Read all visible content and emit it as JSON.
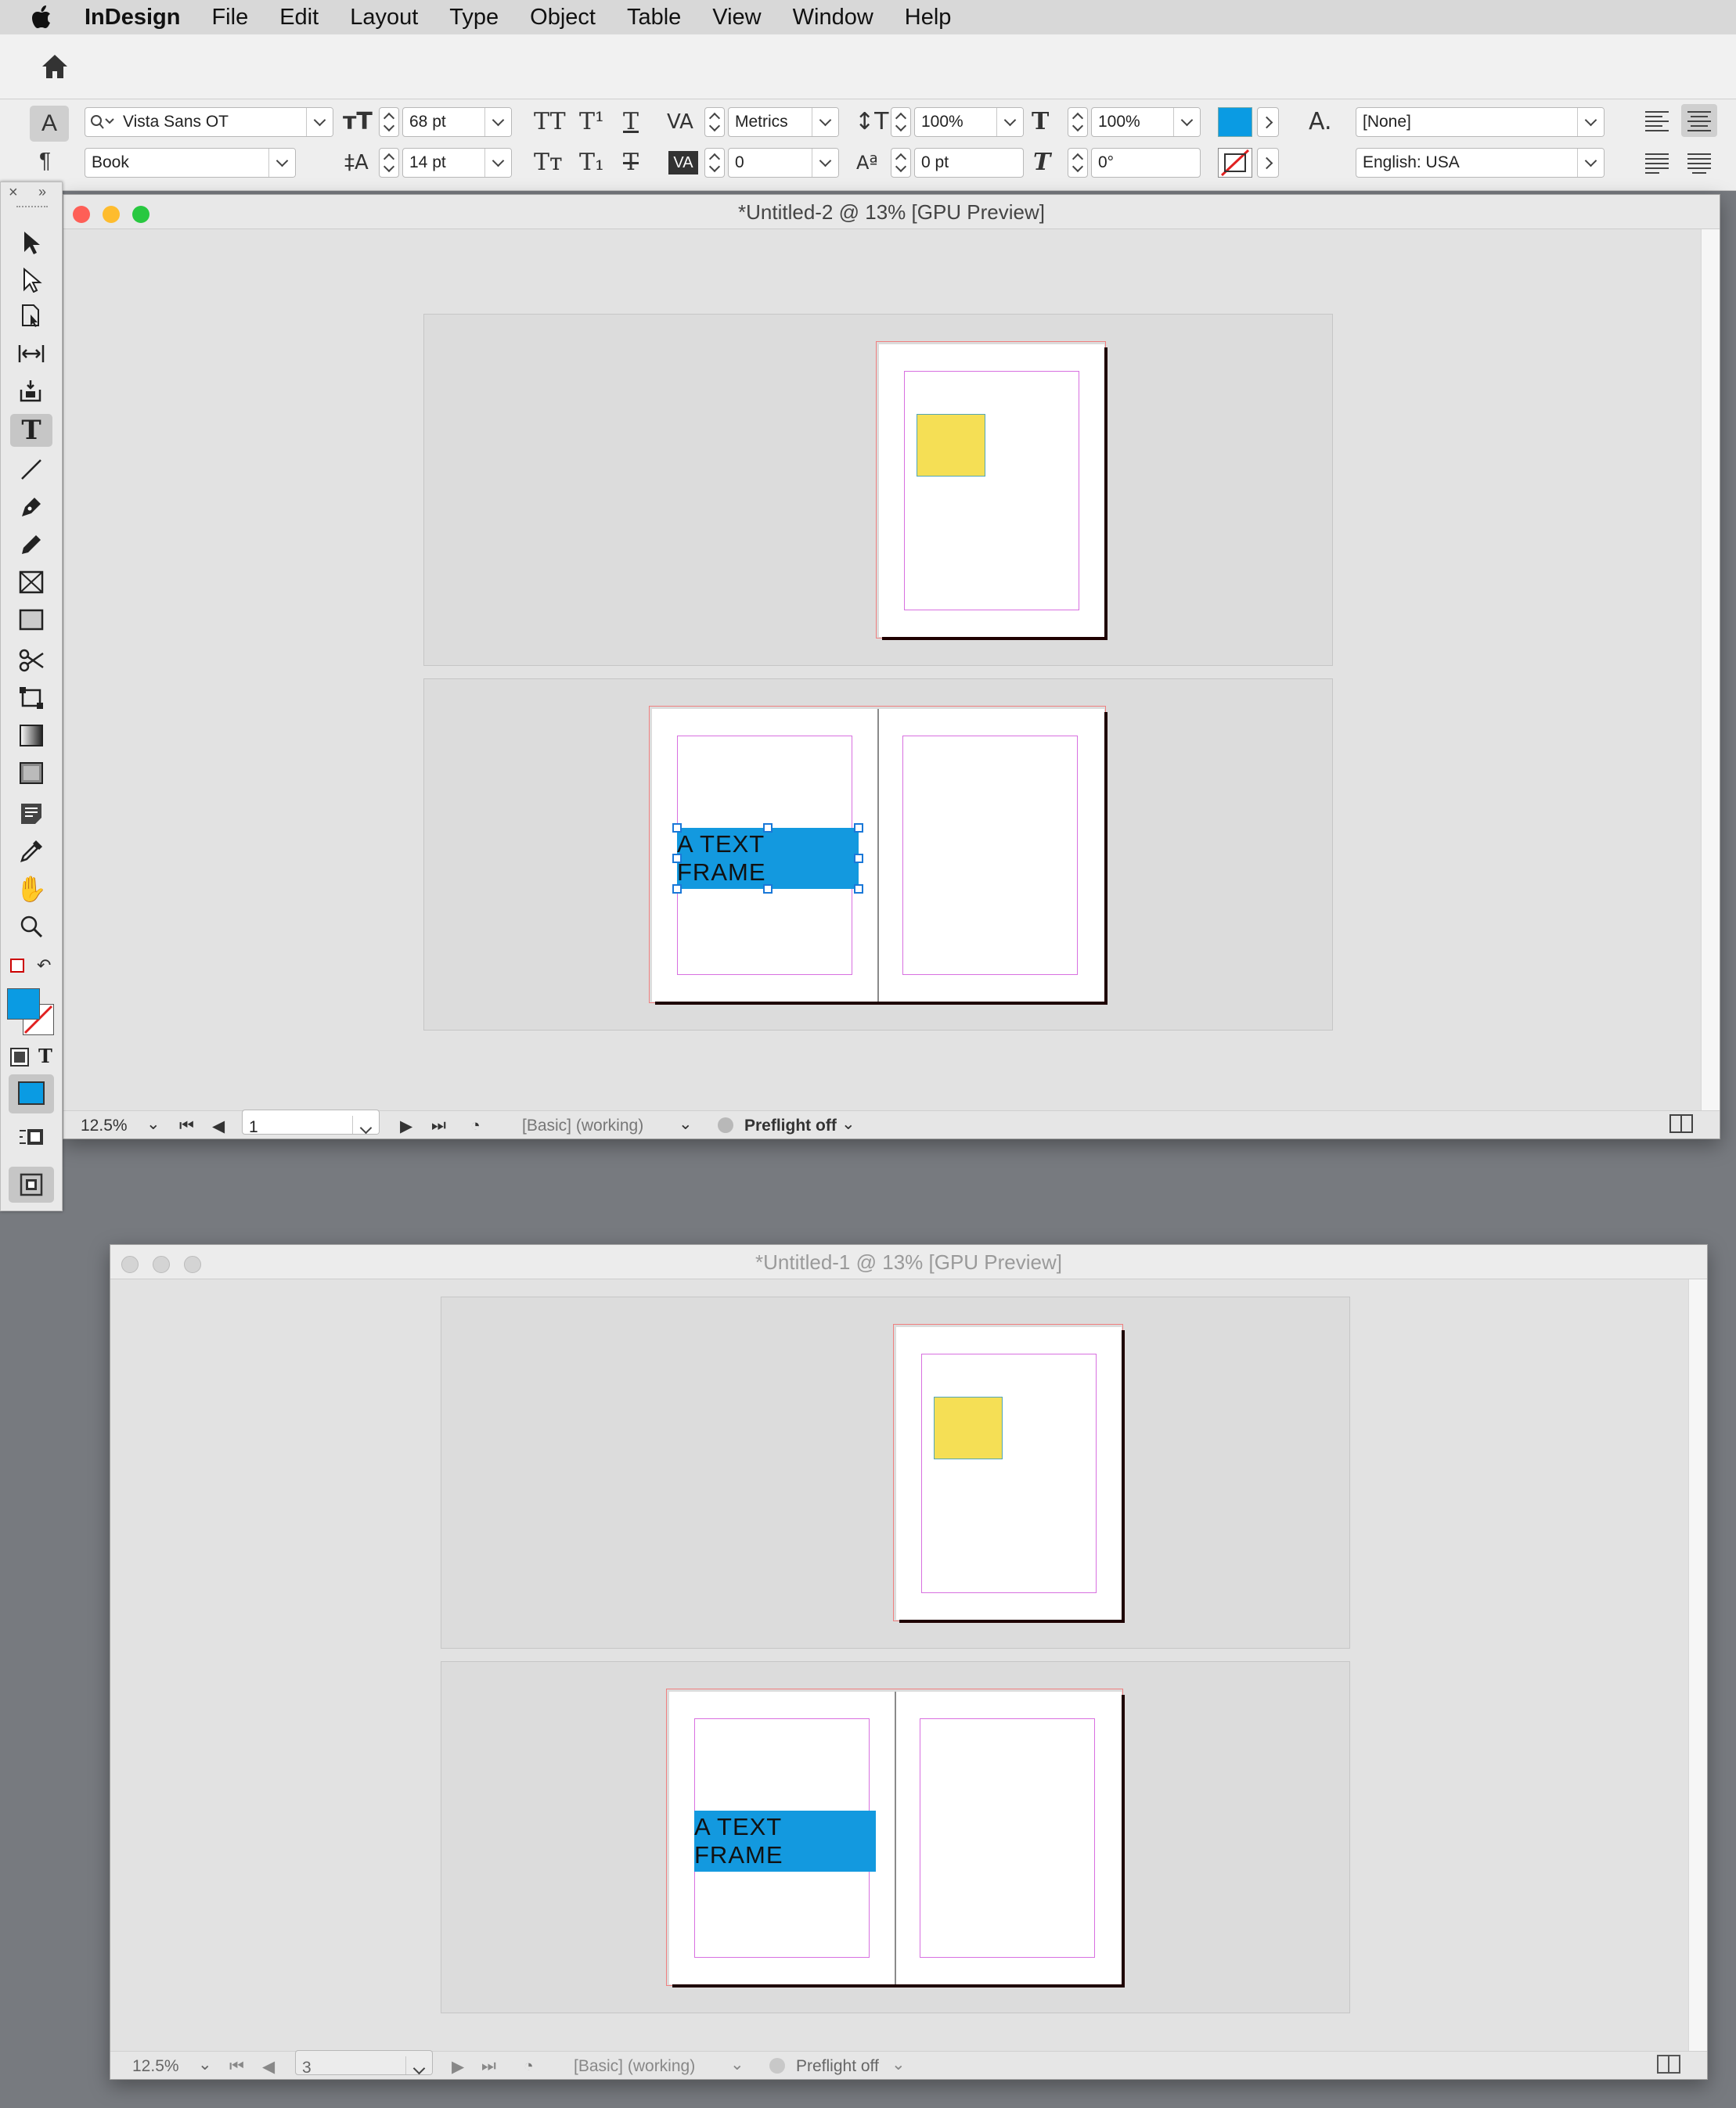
{
  "menubar": {
    "app": "InDesign",
    "items": [
      "File",
      "Edit",
      "Layout",
      "Type",
      "Object",
      "Table",
      "View",
      "Window",
      "Help"
    ]
  },
  "control": {
    "font_family": "Vista Sans OT",
    "font_style": "Book",
    "font_size": "68 pt",
    "leading": "14 pt",
    "kerning": "Metrics",
    "tracking": "0",
    "vertical_scale": "100%",
    "horizontal_scale": "100%",
    "baseline_shift": "0 pt",
    "skew": "0°",
    "char_style": "[None]",
    "language": "English: USA",
    "fill_color": "#0a9be3",
    "icons": {
      "caps": "TT",
      "superscript": "T¹",
      "underline": "T",
      "smallcaps": "Tт",
      "subscript": "T₁",
      "strikethrough": "T"
    }
  },
  "doc2": {
    "title": "*Untitled-2 @ 13% [GPU Preview]",
    "zoom": "12.5%",
    "page": "1",
    "preflight_profile": "[Basic] (working)",
    "preflight": "Preflight off",
    "text_frame": "A TEXT FRAME"
  },
  "doc1": {
    "title": "*Untitled-1 @ 13% [GPU Preview]",
    "zoom": "12.5%",
    "page": "3",
    "preflight_profile": "[Basic] (working)",
    "preflight": "Preflight off",
    "text_frame": "A TEXT FRAME"
  },
  "colors": {
    "accent_blue": "#1399df",
    "yellow": "#f5df55",
    "margin_guide": "#d870e0",
    "close": "#fe5f57",
    "minimize": "#febc2e",
    "zoom": "#28c840"
  }
}
